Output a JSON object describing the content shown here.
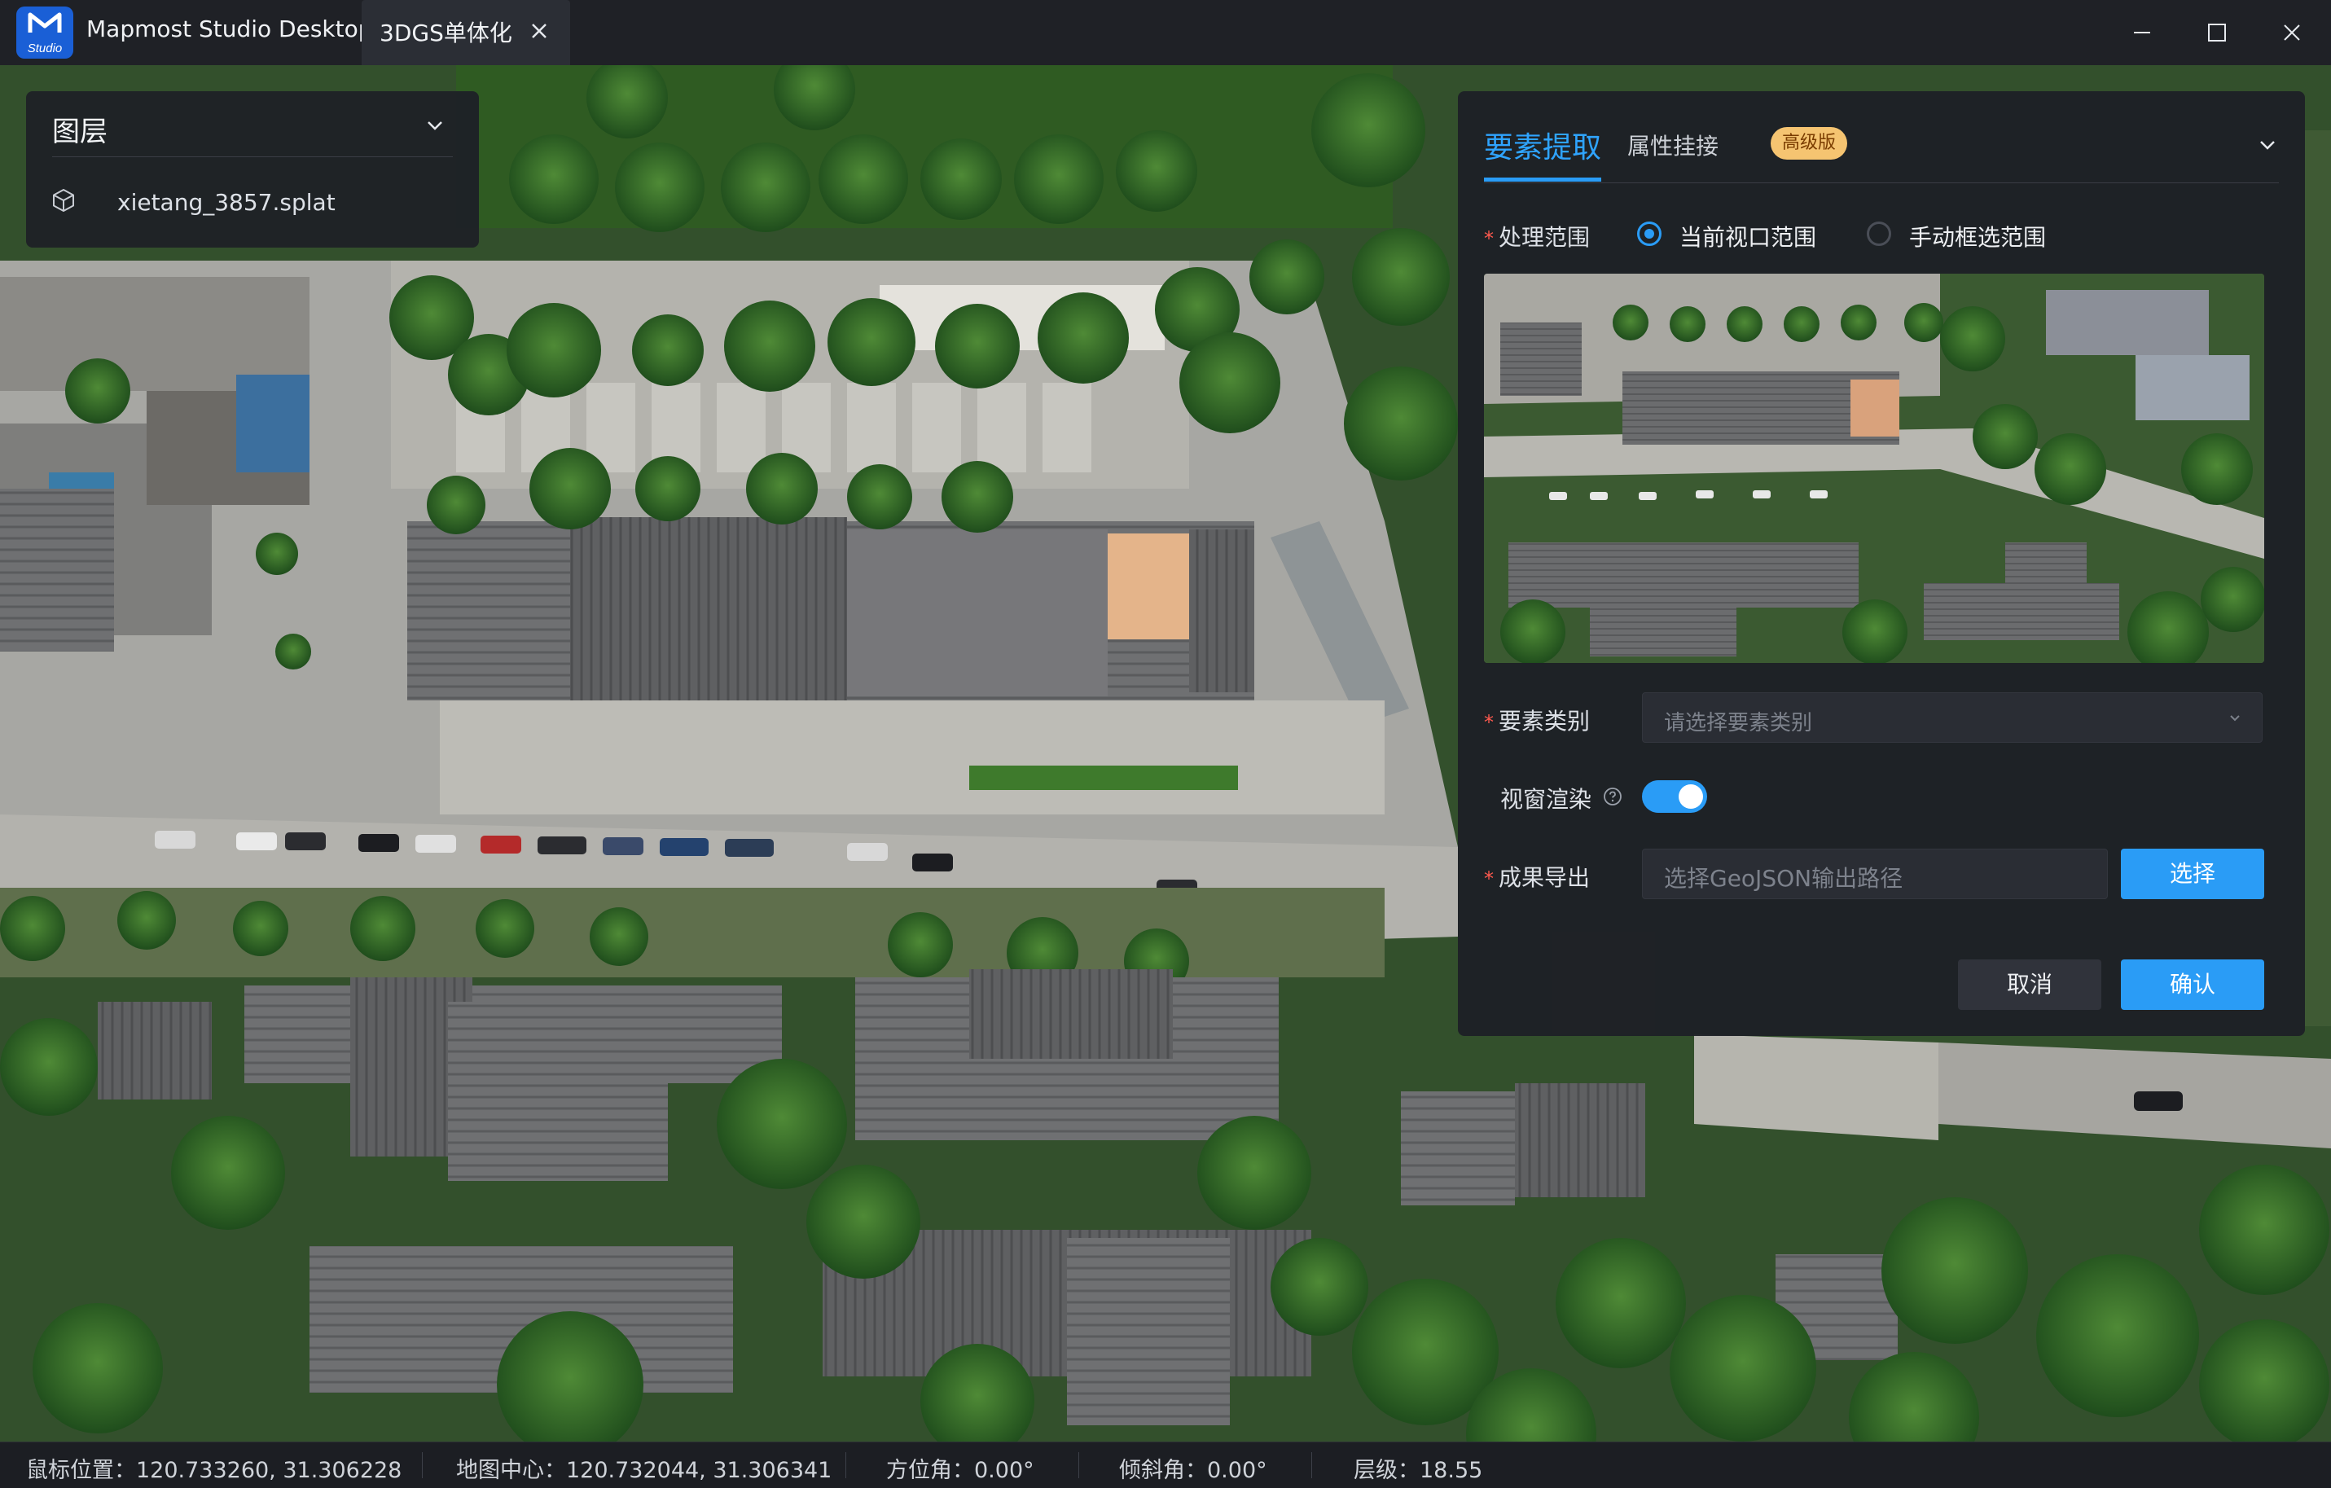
{
  "window": {
    "app_title": "Mapmost Studio Desktop",
    "logo_badge": "Studio",
    "tab_label": "3DGS单体化"
  },
  "layers": {
    "title": "图层",
    "items": [
      {
        "name": "xietang_3857.splat",
        "icon": "cube-icon"
      }
    ]
  },
  "extract": {
    "tab_active": "要素提取",
    "tab_other": "属性挂接",
    "badge": "高级版",
    "range_label": "处理范围",
    "range_options": [
      {
        "label": "当前视口范围",
        "selected": true
      },
      {
        "label": "手动框选范围",
        "selected": false
      }
    ],
    "category_label": "要素类别",
    "category_placeholder": "请选择要素类别",
    "render_label": "视窗渲染",
    "render_enabled": true,
    "export_label": "成果导出",
    "export_placeholder": "选择GeoJSON输出路径",
    "choose_button": "选择",
    "cancel_button": "取消",
    "confirm_button": "确认"
  },
  "statusbar": {
    "mouse_pos": "鼠标位置：120.733260, 31.306228",
    "map_center": "地图中心：120.732044, 31.306341",
    "bearing": "方位角：0.00°",
    "pitch": "倾斜角：0.00°",
    "zoom": "层级：18.55"
  },
  "colors": {
    "accent": "#2a9cf6",
    "badge_bg": "#f5c471",
    "required": "#ff5a4f",
    "panel_bg": "#1e2026"
  }
}
